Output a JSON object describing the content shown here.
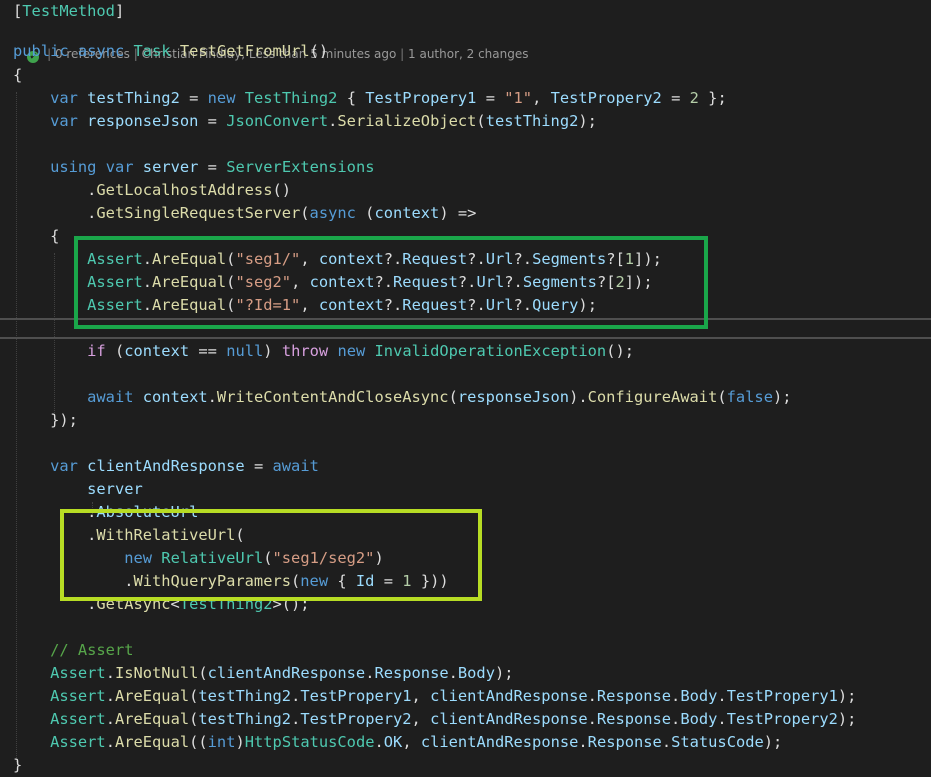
{
  "codelens": {
    "references": "0 references",
    "author_info": "Christian Findlay, Less than 5 minutes ago",
    "changes": "1 author, 2 changes"
  },
  "colors": {
    "background": "#1e1e1e",
    "keyword": "#569cd6",
    "type": "#4ec9b0",
    "method": "#dcdcaa",
    "variable": "#9cdcfe",
    "string": "#d69d85",
    "number": "#b5cea8",
    "comment": "#57a64a",
    "control": "#d8a0df",
    "highlight_box_1": "#1aa64a",
    "highlight_box_2": "#b7dc24"
  },
  "code_lines": [
    [
      {
        "t": "[",
        "c": "pl"
      },
      {
        "t": "TestMethod",
        "c": "ty"
      },
      {
        "t": "]",
        "c": "pl"
      }
    ],
    [],
    [
      {
        "t": "public",
        "c": "kw"
      },
      {
        "t": " ",
        "c": "pl"
      },
      {
        "t": "async",
        "c": "kw"
      },
      {
        "t": " ",
        "c": "pl"
      },
      {
        "t": "Task",
        "c": "ty"
      },
      {
        "t": " ",
        "c": "pl"
      },
      {
        "t": "TestGetFromUrl",
        "c": "me"
      },
      {
        "t": "()",
        "c": "pl"
      }
    ],
    [
      {
        "t": "{",
        "c": "pl"
      }
    ],
    [
      {
        "t": "    ",
        "c": "pl"
      },
      {
        "t": "var",
        "c": "kw"
      },
      {
        "t": " ",
        "c": "pl"
      },
      {
        "t": "testThing2",
        "c": "va"
      },
      {
        "t": " = ",
        "c": "pl"
      },
      {
        "t": "new",
        "c": "kw"
      },
      {
        "t": " ",
        "c": "pl"
      },
      {
        "t": "TestThing2",
        "c": "ty"
      },
      {
        "t": " { ",
        "c": "pl"
      },
      {
        "t": "TestPropery1",
        "c": "va"
      },
      {
        "t": " = ",
        "c": "pl"
      },
      {
        "t": "\"1\"",
        "c": "st"
      },
      {
        "t": ", ",
        "c": "pl"
      },
      {
        "t": "TestPropery2",
        "c": "va"
      },
      {
        "t": " = ",
        "c": "pl"
      },
      {
        "t": "2",
        "c": "nu"
      },
      {
        "t": " };",
        "c": "pl"
      }
    ],
    [
      {
        "t": "    ",
        "c": "pl"
      },
      {
        "t": "var",
        "c": "kw"
      },
      {
        "t": " ",
        "c": "pl"
      },
      {
        "t": "responseJson",
        "c": "va"
      },
      {
        "t": " = ",
        "c": "pl"
      },
      {
        "t": "JsonConvert",
        "c": "ty"
      },
      {
        "t": ".",
        "c": "pl"
      },
      {
        "t": "SerializeObject",
        "c": "me"
      },
      {
        "t": "(",
        "c": "pl"
      },
      {
        "t": "testThing2",
        "c": "va"
      },
      {
        "t": ");",
        "c": "pl"
      }
    ],
    [],
    [
      {
        "t": "    ",
        "c": "pl"
      },
      {
        "t": "using",
        "c": "kw"
      },
      {
        "t": " ",
        "c": "pl"
      },
      {
        "t": "var",
        "c": "kw"
      },
      {
        "t": " ",
        "c": "pl"
      },
      {
        "t": "server",
        "c": "va"
      },
      {
        "t": " = ",
        "c": "pl"
      },
      {
        "t": "ServerExtensions",
        "c": "ty"
      }
    ],
    [
      {
        "t": "        .",
        "c": "pl"
      },
      {
        "t": "GetLocalhostAddress",
        "c": "me"
      },
      {
        "t": "()",
        "c": "pl"
      }
    ],
    [
      {
        "t": "        .",
        "c": "pl"
      },
      {
        "t": "GetSingleRequestServer",
        "c": "me"
      },
      {
        "t": "(",
        "c": "pl"
      },
      {
        "t": "async",
        "c": "kw"
      },
      {
        "t": " (",
        "c": "pl"
      },
      {
        "t": "context",
        "c": "va"
      },
      {
        "t": ") =>",
        "c": "pl"
      }
    ],
    [
      {
        "t": "    {",
        "c": "pl"
      }
    ],
    [
      {
        "t": "        ",
        "c": "pl"
      },
      {
        "t": "Assert",
        "c": "ty"
      },
      {
        "t": ".",
        "c": "pl"
      },
      {
        "t": "AreEqual",
        "c": "me"
      },
      {
        "t": "(",
        "c": "pl"
      },
      {
        "t": "\"seg1/\"",
        "c": "st"
      },
      {
        "t": ", ",
        "c": "pl"
      },
      {
        "t": "context",
        "c": "va"
      },
      {
        "t": "?.",
        "c": "pl"
      },
      {
        "t": "Request",
        "c": "va"
      },
      {
        "t": "?.",
        "c": "pl"
      },
      {
        "t": "Url",
        "c": "va"
      },
      {
        "t": "?.",
        "c": "pl"
      },
      {
        "t": "Segments",
        "c": "va"
      },
      {
        "t": "?[",
        "c": "pl"
      },
      {
        "t": "1",
        "c": "nu"
      },
      {
        "t": "]);",
        "c": "pl"
      }
    ],
    [
      {
        "t": "        ",
        "c": "pl"
      },
      {
        "t": "Assert",
        "c": "ty"
      },
      {
        "t": ".",
        "c": "pl"
      },
      {
        "t": "AreEqual",
        "c": "me"
      },
      {
        "t": "(",
        "c": "pl"
      },
      {
        "t": "\"seg2\"",
        "c": "st"
      },
      {
        "t": ", ",
        "c": "pl"
      },
      {
        "t": "context",
        "c": "va"
      },
      {
        "t": "?.",
        "c": "pl"
      },
      {
        "t": "Request",
        "c": "va"
      },
      {
        "t": "?.",
        "c": "pl"
      },
      {
        "t": "Url",
        "c": "va"
      },
      {
        "t": "?.",
        "c": "pl"
      },
      {
        "t": "Segments",
        "c": "va"
      },
      {
        "t": "?[",
        "c": "pl"
      },
      {
        "t": "2",
        "c": "nu"
      },
      {
        "t": "]);",
        "c": "pl"
      }
    ],
    [
      {
        "t": "        ",
        "c": "pl"
      },
      {
        "t": "Assert",
        "c": "ty"
      },
      {
        "t": ".",
        "c": "pl"
      },
      {
        "t": "AreEqual",
        "c": "me"
      },
      {
        "t": "(",
        "c": "pl"
      },
      {
        "t": "\"?Id=1\"",
        "c": "st"
      },
      {
        "t": ", ",
        "c": "pl"
      },
      {
        "t": "context",
        "c": "va"
      },
      {
        "t": "?.",
        "c": "pl"
      },
      {
        "t": "Request",
        "c": "va"
      },
      {
        "t": "?.",
        "c": "pl"
      },
      {
        "t": "Url",
        "c": "va"
      },
      {
        "t": "?.",
        "c": "pl"
      },
      {
        "t": "Query",
        "c": "va"
      },
      {
        "t": ");",
        "c": "pl"
      }
    ],
    [],
    [
      {
        "t": "        ",
        "c": "pl"
      },
      {
        "t": "if",
        "c": "ct"
      },
      {
        "t": " (",
        "c": "pl"
      },
      {
        "t": "context",
        "c": "va"
      },
      {
        "t": " == ",
        "c": "pl"
      },
      {
        "t": "null",
        "c": "kw"
      },
      {
        "t": ") ",
        "c": "pl"
      },
      {
        "t": "throw",
        "c": "ct"
      },
      {
        "t": " ",
        "c": "pl"
      },
      {
        "t": "new",
        "c": "kw"
      },
      {
        "t": " ",
        "c": "pl"
      },
      {
        "t": "InvalidOperationException",
        "c": "ty"
      },
      {
        "t": "();",
        "c": "pl"
      }
    ],
    [],
    [
      {
        "t": "        ",
        "c": "pl"
      },
      {
        "t": "await",
        "c": "kw"
      },
      {
        "t": " ",
        "c": "pl"
      },
      {
        "t": "context",
        "c": "va"
      },
      {
        "t": ".",
        "c": "pl"
      },
      {
        "t": "WriteContentAndCloseAsync",
        "c": "me"
      },
      {
        "t": "(",
        "c": "pl"
      },
      {
        "t": "responseJson",
        "c": "va"
      },
      {
        "t": ").",
        "c": "pl"
      },
      {
        "t": "ConfigureAwait",
        "c": "me"
      },
      {
        "t": "(",
        "c": "pl"
      },
      {
        "t": "false",
        "c": "kw"
      },
      {
        "t": ");",
        "c": "pl"
      }
    ],
    [
      {
        "t": "    });",
        "c": "pl"
      }
    ],
    [],
    [
      {
        "t": "    ",
        "c": "pl"
      },
      {
        "t": "var",
        "c": "kw"
      },
      {
        "t": " ",
        "c": "pl"
      },
      {
        "t": "clientAndResponse",
        "c": "va"
      },
      {
        "t": " = ",
        "c": "pl"
      },
      {
        "t": "await",
        "c": "kw"
      }
    ],
    [
      {
        "t": "        ",
        "c": "pl"
      },
      {
        "t": "server",
        "c": "va"
      }
    ],
    [
      {
        "t": "        .",
        "c": "pl"
      },
      {
        "t": "AbsoluteUrl",
        "c": "va"
      }
    ],
    [
      {
        "t": "        .",
        "c": "pl"
      },
      {
        "t": "WithRelativeUrl",
        "c": "me"
      },
      {
        "t": "(",
        "c": "pl"
      }
    ],
    [
      {
        "t": "            ",
        "c": "pl"
      },
      {
        "t": "new",
        "c": "kw"
      },
      {
        "t": " ",
        "c": "pl"
      },
      {
        "t": "RelativeUrl",
        "c": "ty"
      },
      {
        "t": "(",
        "c": "pl"
      },
      {
        "t": "\"seg1/seg2\"",
        "c": "st"
      },
      {
        "t": ")",
        "c": "pl"
      }
    ],
    [
      {
        "t": "            .",
        "c": "pl"
      },
      {
        "t": "WithQueryParamers",
        "c": "me"
      },
      {
        "t": "(",
        "c": "pl"
      },
      {
        "t": "new",
        "c": "kw"
      },
      {
        "t": " { ",
        "c": "pl"
      },
      {
        "t": "Id",
        "c": "va"
      },
      {
        "t": " = ",
        "c": "pl"
      },
      {
        "t": "1",
        "c": "nu"
      },
      {
        "t": " }))",
        "c": "pl"
      }
    ],
    [
      {
        "t": "        .",
        "c": "pl"
      },
      {
        "t": "GetAsync",
        "c": "me"
      },
      {
        "t": "<",
        "c": "pl"
      },
      {
        "t": "TestThing2",
        "c": "ty"
      },
      {
        "t": ">();",
        "c": "pl"
      }
    ],
    [],
    [
      {
        "t": "    ",
        "c": "pl"
      },
      {
        "t": "// Assert",
        "c": "cm"
      }
    ],
    [
      {
        "t": "    ",
        "c": "pl"
      },
      {
        "t": "Assert",
        "c": "ty"
      },
      {
        "t": ".",
        "c": "pl"
      },
      {
        "t": "IsNotNull",
        "c": "me"
      },
      {
        "t": "(",
        "c": "pl"
      },
      {
        "t": "clientAndResponse",
        "c": "va"
      },
      {
        "t": ".",
        "c": "pl"
      },
      {
        "t": "Response",
        "c": "va"
      },
      {
        "t": ".",
        "c": "pl"
      },
      {
        "t": "Body",
        "c": "va"
      },
      {
        "t": ");",
        "c": "pl"
      }
    ],
    [
      {
        "t": "    ",
        "c": "pl"
      },
      {
        "t": "Assert",
        "c": "ty"
      },
      {
        "t": ".",
        "c": "pl"
      },
      {
        "t": "AreEqual",
        "c": "me"
      },
      {
        "t": "(",
        "c": "pl"
      },
      {
        "t": "testThing2",
        "c": "va"
      },
      {
        "t": ".",
        "c": "pl"
      },
      {
        "t": "TestPropery1",
        "c": "va"
      },
      {
        "t": ", ",
        "c": "pl"
      },
      {
        "t": "clientAndResponse",
        "c": "va"
      },
      {
        "t": ".",
        "c": "pl"
      },
      {
        "t": "Response",
        "c": "va"
      },
      {
        "t": ".",
        "c": "pl"
      },
      {
        "t": "Body",
        "c": "va"
      },
      {
        "t": ".",
        "c": "pl"
      },
      {
        "t": "TestPropery1",
        "c": "va"
      },
      {
        "t": ");",
        "c": "pl"
      }
    ],
    [
      {
        "t": "    ",
        "c": "pl"
      },
      {
        "t": "Assert",
        "c": "ty"
      },
      {
        "t": ".",
        "c": "pl"
      },
      {
        "t": "AreEqual",
        "c": "me"
      },
      {
        "t": "(",
        "c": "pl"
      },
      {
        "t": "testThing2",
        "c": "va"
      },
      {
        "t": ".",
        "c": "pl"
      },
      {
        "t": "TestPropery2",
        "c": "va"
      },
      {
        "t": ", ",
        "c": "pl"
      },
      {
        "t": "clientAndResponse",
        "c": "va"
      },
      {
        "t": ".",
        "c": "pl"
      },
      {
        "t": "Response",
        "c": "va"
      },
      {
        "t": ".",
        "c": "pl"
      },
      {
        "t": "Body",
        "c": "va"
      },
      {
        "t": ".",
        "c": "pl"
      },
      {
        "t": "TestPropery2",
        "c": "va"
      },
      {
        "t": ");",
        "c": "pl"
      }
    ],
    [
      {
        "t": "    ",
        "c": "pl"
      },
      {
        "t": "Assert",
        "c": "ty"
      },
      {
        "t": ".",
        "c": "pl"
      },
      {
        "t": "AreEqual",
        "c": "me"
      },
      {
        "t": "((",
        "c": "pl"
      },
      {
        "t": "int",
        "c": "kw"
      },
      {
        "t": ")",
        "c": "pl"
      },
      {
        "t": "HttpStatusCode",
        "c": "ty"
      },
      {
        "t": ".",
        "c": "pl"
      },
      {
        "t": "OK",
        "c": "va"
      },
      {
        "t": ", ",
        "c": "pl"
      },
      {
        "t": "clientAndResponse",
        "c": "va"
      },
      {
        "t": ".",
        "c": "pl"
      },
      {
        "t": "Response",
        "c": "va"
      },
      {
        "t": ".",
        "c": "pl"
      },
      {
        "t": "StatusCode",
        "c": "va"
      },
      {
        "t": ");",
        "c": "pl"
      }
    ],
    [
      {
        "t": "}",
        "c": "pl"
      }
    ]
  ]
}
